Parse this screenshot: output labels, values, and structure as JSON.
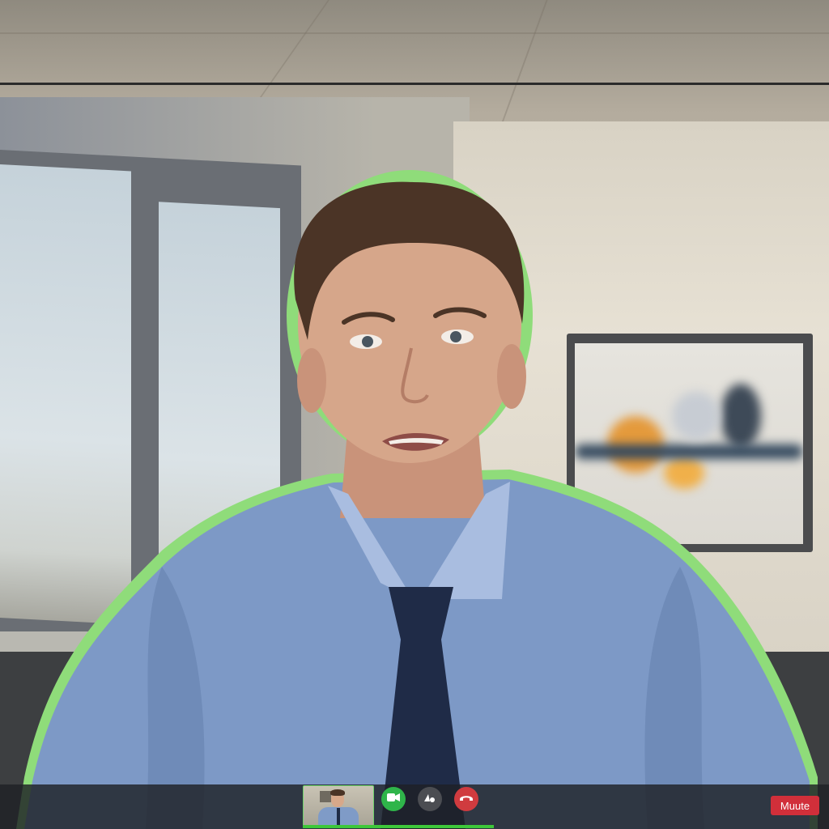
{
  "call": {
    "controls": {
      "video_icon": "video-camera-icon",
      "share_icon": "share-icon",
      "hangup_icon": "phone-hangup-icon",
      "mute_label": "Muute"
    },
    "colors": {
      "video_button": "#2fb54a",
      "share_button": "#4b4d52",
      "hangup_button": "#d03b3f",
      "mute_button": "#d12f3a",
      "active_outline": "#6fd36a"
    }
  }
}
